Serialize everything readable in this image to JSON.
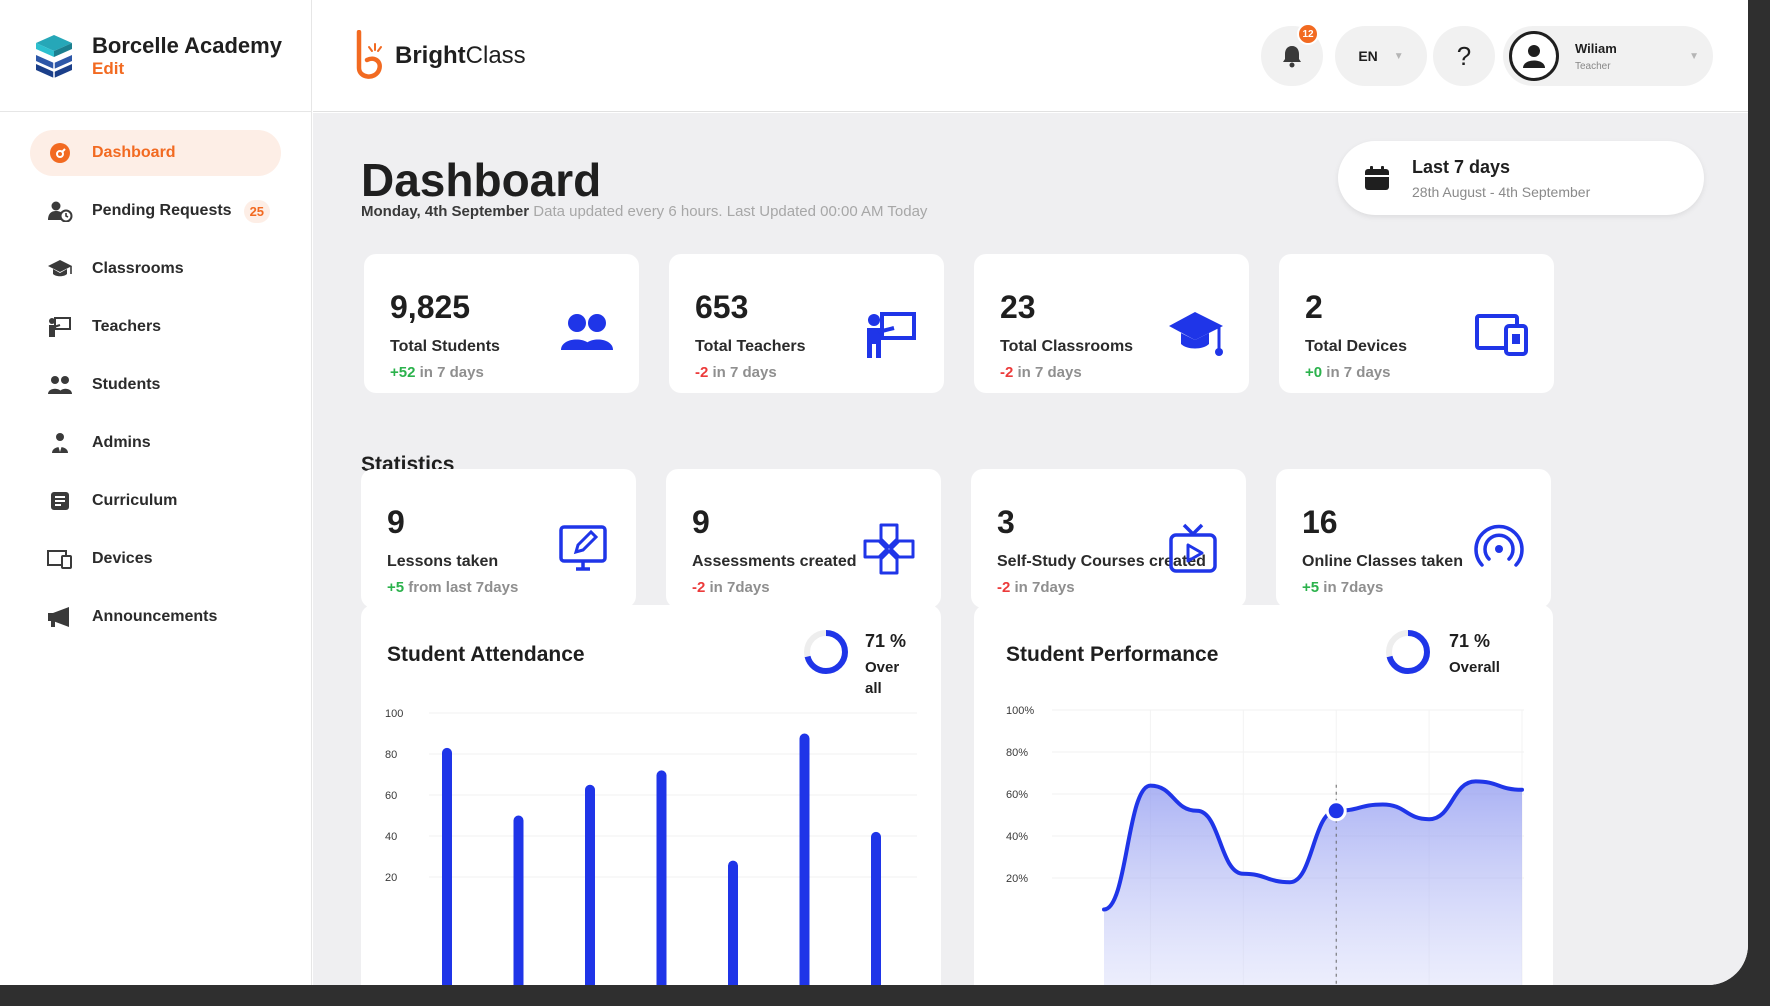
{
  "brand": {
    "name": "Borcelle Academy",
    "edit": "Edit"
  },
  "app": {
    "name_bold": "Bright",
    "name_rest": "Class"
  },
  "sidebar": {
    "items": [
      {
        "label": "Dashboard",
        "icon": "dashboard-icon",
        "active": true
      },
      {
        "label": "Pending Requests",
        "icon": "pending-requests-icon",
        "badge": "25"
      },
      {
        "label": "Classrooms",
        "icon": "graduation-cap-icon"
      },
      {
        "label": "Teachers",
        "icon": "teacher-icon"
      },
      {
        "label": "Students",
        "icon": "students-icon"
      },
      {
        "label": "Admins",
        "icon": "admin-icon"
      },
      {
        "label": "Curriculum",
        "icon": "curriculum-icon"
      },
      {
        "label": "Devices",
        "icon": "devices-icon"
      },
      {
        "label": "Announcements",
        "icon": "megaphone-icon"
      }
    ]
  },
  "topbar": {
    "notifications_count": "12",
    "language": "EN",
    "help": "?",
    "user": {
      "name": "Wiliam",
      "role": "Teacher"
    }
  },
  "header": {
    "title": "Dashboard",
    "date": "Monday, 4th September",
    "update_note": "Data updated every 6 hours. Last Updated 00:00 AM Today",
    "range_title": "Last 7 days",
    "range_dates": "28th August - 4th September"
  },
  "summary": [
    {
      "value": "9,825",
      "label": "Total Students",
      "delta": "+52",
      "delta_suffix": " in 7 days",
      "positive": true
    },
    {
      "value": "653",
      "label": "Total Teachers",
      "delta": "-2",
      "delta_suffix": " in 7 days",
      "positive": false
    },
    {
      "value": "23",
      "label": "Total Classrooms",
      "delta": "-2",
      "delta_suffix": " in 7 days",
      "positive": false
    },
    {
      "value": "2",
      "label": "Total Devices",
      "delta": "+0",
      "delta_suffix": " in 7 days",
      "positive": true
    }
  ],
  "statistics_title": "Statistics",
  "statistics": [
    {
      "value": "9",
      "label": "Lessons taken",
      "delta": "+5",
      "delta_suffix": " from last 7days",
      "positive": true
    },
    {
      "value": "9",
      "label": "Assessments created",
      "delta": "-2",
      "delta_suffix": " in 7days",
      "positive": false
    },
    {
      "value": "3",
      "label": "Self-Study Courses created",
      "delta": "-2",
      "delta_suffix": " in 7days",
      "positive": false
    },
    {
      "value": "16",
      "label": "Online Classes taken",
      "delta": "+5",
      "delta_suffix": " in 7days",
      "positive": true
    }
  ],
  "attendance": {
    "title": "Student Attendance",
    "percent": "71 %",
    "sub": "Over all"
  },
  "performance": {
    "title": "Student Performance",
    "percent": "71 %",
    "sub": "Overall"
  },
  "colors": {
    "accent": "#f26a21",
    "primary": "#1f35e8",
    "positive": "#2bb24c",
    "negative": "#ec3b3b"
  },
  "chart_data": [
    {
      "type": "bar",
      "title": "Student Attendance",
      "yticks": [
        "100",
        "80",
        "60",
        "40",
        "20"
      ],
      "values": [
        83,
        50,
        65,
        72,
        28,
        90,
        42
      ],
      "ylim": [
        0,
        100
      ]
    },
    {
      "type": "area",
      "title": "Student Performance",
      "yticks": [
        "100%",
        "80%",
        "60%",
        "40%",
        "20%"
      ],
      "values": [
        5,
        64,
        52,
        22,
        18,
        52,
        55,
        48,
        66,
        62
      ],
      "highlight_index": 5,
      "ylim": [
        0,
        100
      ]
    }
  ]
}
